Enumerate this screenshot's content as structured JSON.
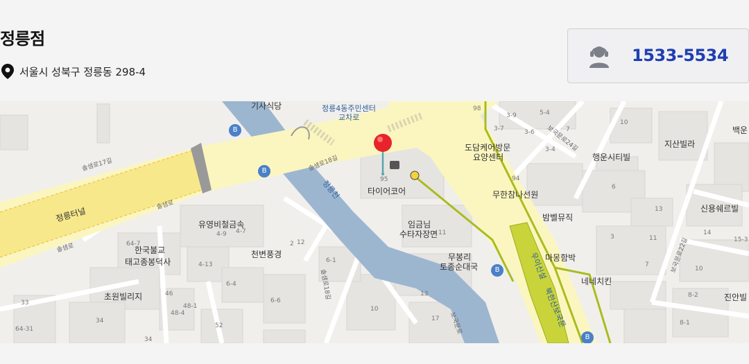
{
  "store": {
    "name": "정릉점",
    "address": "서울시 성북구 정릉동 298-4",
    "phone": "1533-5534"
  },
  "map": {
    "labels": {
      "l1": "기사식당",
      "l2": "정릉4동주민센터",
      "l3": "교차로",
      "l4": "도담케어방문",
      "l5": "요양센터",
      "l6": "타이어코어",
      "l7": "무한참나선원",
      "l8": "밤벨뮤직",
      "l9": "행운시티빌",
      "l10": "지산빌라",
      "l11": "신용쉐르빌",
      "l12": "유영비철금속",
      "l13": "임금님",
      "l14": "수타자장면",
      "l15": "무봉리",
      "l16": "토종순대국",
      "l17": "마몽함박",
      "l18": "네네치킨",
      "l19": "한국불교",
      "l20": "태고종봉덕사",
      "l21": "천변풍경",
      "l22": "초원빌리지",
      "l23": "진안빌",
      "l24": "백운",
      "l25": "정릉터널",
      "l26": "정릉천",
      "l27": "우이신설",
      "l28": "북한산보국문"
    },
    "numbers": {
      "n1": "98",
      "n2": "3-9",
      "n3": "5-4",
      "n4": "3-7",
      "n5": "3-6",
      "n6": "7",
      "n7": "10",
      "n8": "3-4",
      "n9": "94",
      "n10": "6",
      "n11": "13",
      "n12": "14",
      "n13": "3",
      "n14": "11",
      "n15": "15-3",
      "n16": "7",
      "n17": "10",
      "n18": "8-2",
      "n19": "8-1",
      "n20": "95",
      "n21": "4-9",
      "n22": "4-7",
      "n23": "4-13",
      "n24": "6-4",
      "n25": "6-1",
      "n26": "6-6",
      "n27": "10",
      "n28": "13",
      "n29": "17",
      "n30": "2",
      "n31": "33",
      "n32": "34",
      "n33": "64-31",
      "n34": "46",
      "n35": "48-1",
      "n36": "48-4",
      "n37": "52",
      "n38": "34",
      "n39": "64-7",
      "n40": "11",
      "n41": "12"
    },
    "roads": {
      "r1": "솔샘로17길",
      "r2": "솔샘로",
      "r3": "솔샘로",
      "r4": "솔샘로18길",
      "r5": "솔샘로18길",
      "r6": "보국문로24길",
      "r7": "보국문로22길",
      "r8": "보국문로"
    }
  }
}
